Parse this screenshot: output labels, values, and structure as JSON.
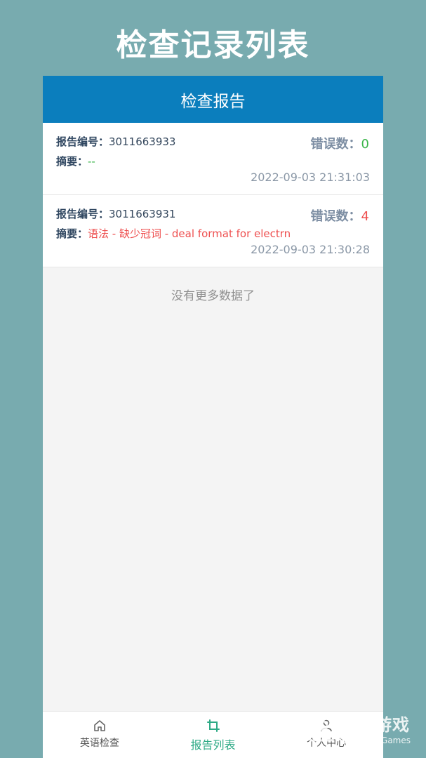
{
  "promo": {
    "title": "检查记录列表"
  },
  "header": {
    "title": "检查报告"
  },
  "reports": [
    {
      "id_label": "报告编号：",
      "id_value": "3011663933",
      "error_label": "错误数：",
      "error_count": "0",
      "summary_label": "摘要：",
      "summary": "--",
      "time": "2022-09-03 21:31:03"
    },
    {
      "id_label": "报告编号：",
      "id_value": "3011663931",
      "error_label": "错误数：",
      "error_count": "4",
      "summary_label": "摘要：",
      "summary": "语法 - 缺少冠词 - deal format for electrn",
      "time": "2022-09-03 21:30:28"
    }
  ],
  "list_end_text": "没有更多数据了",
  "tabbar": {
    "tabs": [
      {
        "label": "英语检查",
        "icon": "home-icon"
      },
      {
        "label": "报告列表",
        "icon": "crop-icon"
      },
      {
        "label": "个人中心",
        "icon": "user-icon"
      }
    ],
    "active_index": 1
  },
  "watermark": {
    "main": "仍玩游戏",
    "sub": "Rengwan Games"
  },
  "colors": {
    "accent": "#0b7ebd",
    "active_tab": "#2eaa86",
    "ok": "#3bb54a",
    "error": "#ee4f4f",
    "backdrop": "#78abaf"
  }
}
